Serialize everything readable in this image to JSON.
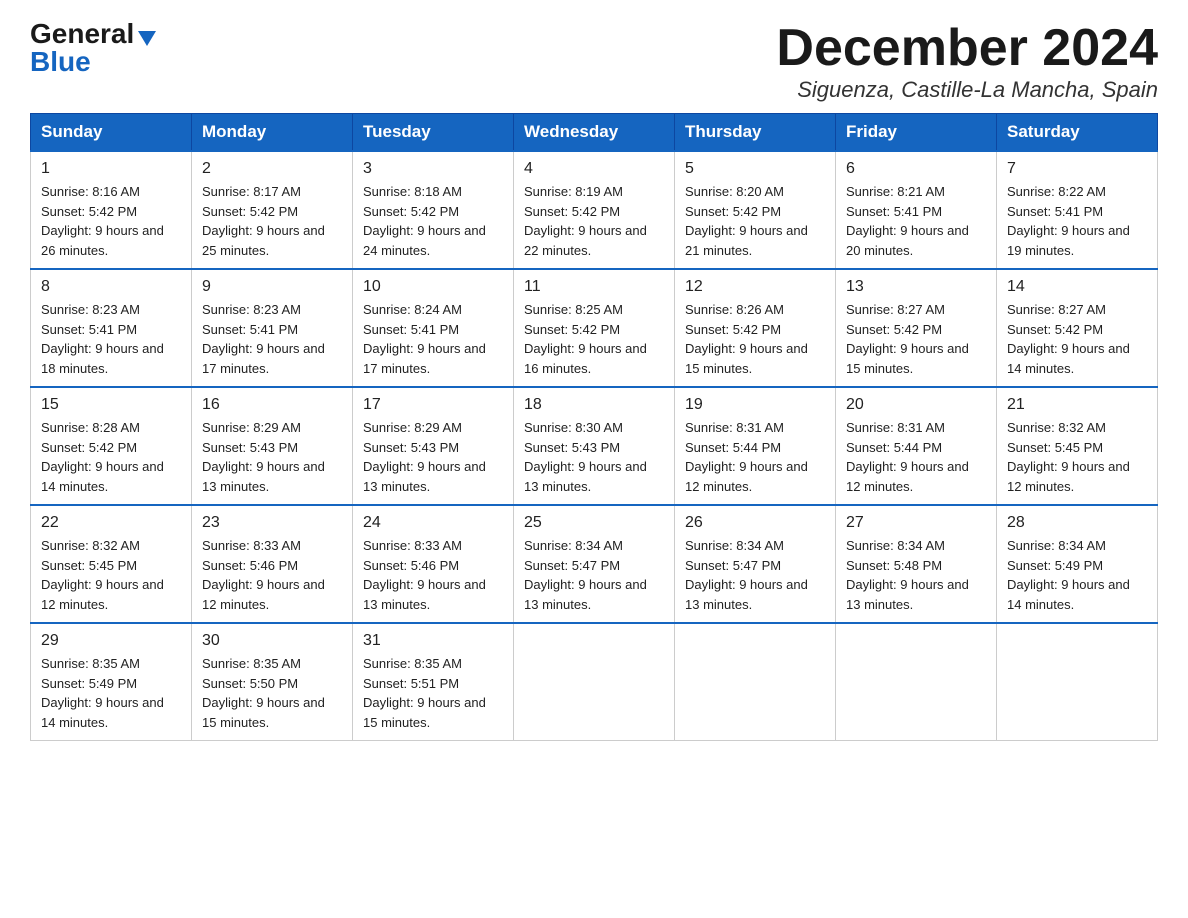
{
  "logo": {
    "general": "General",
    "triangle": "▶",
    "blue": "Blue"
  },
  "title": {
    "month": "December 2024",
    "subtitle": "Siguenza, Castille-La Mancha, Spain"
  },
  "weekdays": [
    "Sunday",
    "Monday",
    "Tuesday",
    "Wednesday",
    "Thursday",
    "Friday",
    "Saturday"
  ],
  "weeks": [
    [
      {
        "day": "1",
        "sunrise": "8:16 AM",
        "sunset": "5:42 PM",
        "daylight": "9 hours and 26 minutes."
      },
      {
        "day": "2",
        "sunrise": "8:17 AM",
        "sunset": "5:42 PM",
        "daylight": "9 hours and 25 minutes."
      },
      {
        "day": "3",
        "sunrise": "8:18 AM",
        "sunset": "5:42 PM",
        "daylight": "9 hours and 24 minutes."
      },
      {
        "day": "4",
        "sunrise": "8:19 AM",
        "sunset": "5:42 PM",
        "daylight": "9 hours and 22 minutes."
      },
      {
        "day": "5",
        "sunrise": "8:20 AM",
        "sunset": "5:42 PM",
        "daylight": "9 hours and 21 minutes."
      },
      {
        "day": "6",
        "sunrise": "8:21 AM",
        "sunset": "5:41 PM",
        "daylight": "9 hours and 20 minutes."
      },
      {
        "day": "7",
        "sunrise": "8:22 AM",
        "sunset": "5:41 PM",
        "daylight": "9 hours and 19 minutes."
      }
    ],
    [
      {
        "day": "8",
        "sunrise": "8:23 AM",
        "sunset": "5:41 PM",
        "daylight": "9 hours and 18 minutes."
      },
      {
        "day": "9",
        "sunrise": "8:23 AM",
        "sunset": "5:41 PM",
        "daylight": "9 hours and 17 minutes."
      },
      {
        "day": "10",
        "sunrise": "8:24 AM",
        "sunset": "5:41 PM",
        "daylight": "9 hours and 17 minutes."
      },
      {
        "day": "11",
        "sunrise": "8:25 AM",
        "sunset": "5:42 PM",
        "daylight": "9 hours and 16 minutes."
      },
      {
        "day": "12",
        "sunrise": "8:26 AM",
        "sunset": "5:42 PM",
        "daylight": "9 hours and 15 minutes."
      },
      {
        "day": "13",
        "sunrise": "8:27 AM",
        "sunset": "5:42 PM",
        "daylight": "9 hours and 15 minutes."
      },
      {
        "day": "14",
        "sunrise": "8:27 AM",
        "sunset": "5:42 PM",
        "daylight": "9 hours and 14 minutes."
      }
    ],
    [
      {
        "day": "15",
        "sunrise": "8:28 AM",
        "sunset": "5:42 PM",
        "daylight": "9 hours and 14 minutes."
      },
      {
        "day": "16",
        "sunrise": "8:29 AM",
        "sunset": "5:43 PM",
        "daylight": "9 hours and 13 minutes."
      },
      {
        "day": "17",
        "sunrise": "8:29 AM",
        "sunset": "5:43 PM",
        "daylight": "9 hours and 13 minutes."
      },
      {
        "day": "18",
        "sunrise": "8:30 AM",
        "sunset": "5:43 PM",
        "daylight": "9 hours and 13 minutes."
      },
      {
        "day": "19",
        "sunrise": "8:31 AM",
        "sunset": "5:44 PM",
        "daylight": "9 hours and 12 minutes."
      },
      {
        "day": "20",
        "sunrise": "8:31 AM",
        "sunset": "5:44 PM",
        "daylight": "9 hours and 12 minutes."
      },
      {
        "day": "21",
        "sunrise": "8:32 AM",
        "sunset": "5:45 PM",
        "daylight": "9 hours and 12 minutes."
      }
    ],
    [
      {
        "day": "22",
        "sunrise": "8:32 AM",
        "sunset": "5:45 PM",
        "daylight": "9 hours and 12 minutes."
      },
      {
        "day": "23",
        "sunrise": "8:33 AM",
        "sunset": "5:46 PM",
        "daylight": "9 hours and 12 minutes."
      },
      {
        "day": "24",
        "sunrise": "8:33 AM",
        "sunset": "5:46 PM",
        "daylight": "9 hours and 13 minutes."
      },
      {
        "day": "25",
        "sunrise": "8:34 AM",
        "sunset": "5:47 PM",
        "daylight": "9 hours and 13 minutes."
      },
      {
        "day": "26",
        "sunrise": "8:34 AM",
        "sunset": "5:47 PM",
        "daylight": "9 hours and 13 minutes."
      },
      {
        "day": "27",
        "sunrise": "8:34 AM",
        "sunset": "5:48 PM",
        "daylight": "9 hours and 13 minutes."
      },
      {
        "day": "28",
        "sunrise": "8:34 AM",
        "sunset": "5:49 PM",
        "daylight": "9 hours and 14 minutes."
      }
    ],
    [
      {
        "day": "29",
        "sunrise": "8:35 AM",
        "sunset": "5:49 PM",
        "daylight": "9 hours and 14 minutes."
      },
      {
        "day": "30",
        "sunrise": "8:35 AM",
        "sunset": "5:50 PM",
        "daylight": "9 hours and 15 minutes."
      },
      {
        "day": "31",
        "sunrise": "8:35 AM",
        "sunset": "5:51 PM",
        "daylight": "9 hours and 15 minutes."
      },
      null,
      null,
      null,
      null
    ]
  ]
}
